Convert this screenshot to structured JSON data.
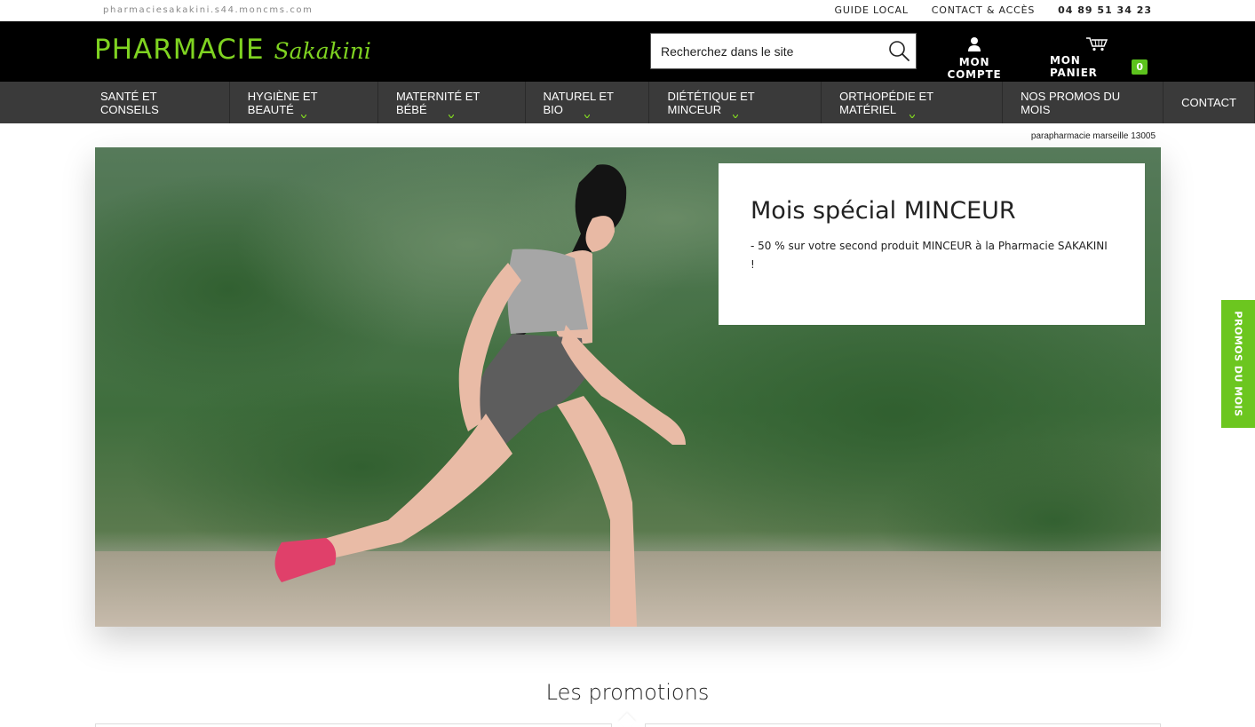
{
  "topbar": {
    "domain": "pharmaciesakakini.s44.moncms.com",
    "links": [
      "GUIDE LOCAL",
      "CONTACT & ACCÈS"
    ],
    "phone": "04 89 51 34 23"
  },
  "header": {
    "logo_main": "PHARMACIE",
    "logo_script": "Sakakini",
    "search_placeholder": "Recherchez dans le site",
    "account_label": "MON COMPTE",
    "cart_label": "MON PANIER",
    "cart_count": "0"
  },
  "nav": {
    "items": [
      {
        "label": "SANTÉ ET CONSEILS",
        "dropdown": false
      },
      {
        "label": "HYGIÈNE ET BEAUTÉ",
        "dropdown": true
      },
      {
        "label": "MATERNITÉ ET BÉBÉ",
        "dropdown": true
      },
      {
        "label": "NATUREL ET BIO",
        "dropdown": true
      },
      {
        "label": "DIÉTÉTIQUE ET MINCEUR",
        "dropdown": true
      },
      {
        "label": "ORTHOPÉDIE ET MATÉRIEL",
        "dropdown": true
      },
      {
        "label": "NOS PROMOS DU MOIS",
        "dropdown": false
      },
      {
        "label": "CONTACT",
        "dropdown": false
      }
    ]
  },
  "hero": {
    "note": "parapharmacie marseille 13005",
    "title": "Mois spécial MINCEUR",
    "text": "- 50 % sur votre second produit MINCEUR à la Pharmacie SAKAKINI !"
  },
  "side_tab": {
    "label": "PROMOS DU MOIS"
  },
  "promotions": {
    "title": "Les promotions"
  },
  "colors": {
    "brand_green": "#7fd321",
    "badge_green": "#5cc21d",
    "header_bg": "#000000",
    "nav_bg": "#3a3a3a",
    "side_tab_bg": "#6cc61f"
  }
}
